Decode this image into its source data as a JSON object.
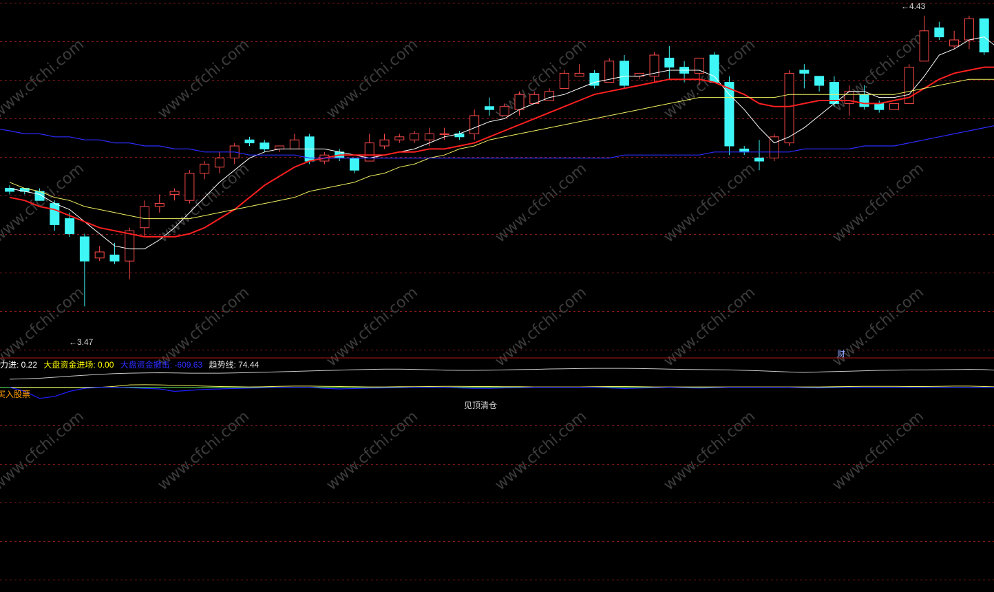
{
  "colors": {
    "background": "#000000",
    "grid": "#8b1a1a",
    "panel_divider": "#b01818",
    "candle_up": "#ff4a4a",
    "candle_down": "#3ff6f6",
    "ma5": "#ffffff",
    "ma10": "#ff2020",
    "ma20": "#f0f060",
    "ma60": "#2c2cff",
    "trend_line": "#c8c8c8",
    "buy_bar": "#ff9e00",
    "hold_bar": "#15a1d8",
    "clear_bar": "#8c8c8c",
    "fund_line": "#1f1fff",
    "zero_line": "#50e050"
  },
  "price_panel": {
    "high_label": "4.43",
    "low_label": "3.47",
    "fin_marker": "财"
  },
  "indicator_panel": {
    "header": [
      {
        "text": "力进: 0.22",
        "color": "#ffffff"
      },
      {
        "text": "大盘资金进场: 0.00",
        "color": "#ffff00"
      },
      {
        "text": "大盘资金撤击: -609.63",
        "color": "#2c2cff"
      },
      {
        "text": "趋势线: 74.44",
        "color": "#e0e0e0"
      }
    ],
    "buy_label": "买入股票",
    "clear_label": "见顶清仓"
  },
  "watermark": "www.cfchi.com",
  "chart_data": {
    "type": "candlestick",
    "title": "",
    "y_range": [
      3.3,
      4.45
    ],
    "candles": [
      {
        "o": 3.86,
        "h": 3.87,
        "l": 3.84,
        "c": 3.85
      },
      {
        "o": 3.86,
        "h": 3.86,
        "l": 3.84,
        "c": 3.85
      },
      {
        "o": 3.85,
        "h": 3.86,
        "l": 3.82,
        "c": 3.82
      },
      {
        "o": 3.81,
        "h": 3.82,
        "l": 3.72,
        "c": 3.74
      },
      {
        "o": 3.76,
        "h": 3.78,
        "l": 3.7,
        "c": 3.71
      },
      {
        "o": 3.7,
        "h": 3.71,
        "l": 3.47,
        "c": 3.62
      },
      {
        "o": 3.63,
        "h": 3.67,
        "l": 3.62,
        "c": 3.65
      },
      {
        "o": 3.64,
        "h": 3.68,
        "l": 3.61,
        "c": 3.62
      },
      {
        "o": 3.62,
        "h": 3.73,
        "l": 3.56,
        "c": 3.72
      },
      {
        "o": 3.73,
        "h": 3.82,
        "l": 3.7,
        "c": 3.8
      },
      {
        "o": 3.8,
        "h": 3.84,
        "l": 3.78,
        "c": 3.81
      },
      {
        "o": 3.84,
        "h": 3.86,
        "l": 3.82,
        "c": 3.85
      },
      {
        "o": 3.82,
        "h": 3.92,
        "l": 3.81,
        "c": 3.91
      },
      {
        "o": 3.91,
        "h": 3.95,
        "l": 3.89,
        "c": 3.94
      },
      {
        "o": 3.93,
        "h": 3.98,
        "l": 3.91,
        "c": 3.96
      },
      {
        "o": 3.96,
        "h": 4.01,
        "l": 3.94,
        "c": 4.0
      },
      {
        "o": 4.02,
        "h": 4.03,
        "l": 4.0,
        "c": 4.01
      },
      {
        "o": 4.01,
        "h": 4.02,
        "l": 3.98,
        "c": 3.99
      },
      {
        "o": 3.99,
        "h": 4.0,
        "l": 3.98,
        "c": 4.0
      },
      {
        "o": 3.99,
        "h": 4.04,
        "l": 3.99,
        "c": 4.02
      },
      {
        "o": 4.03,
        "h": 4.04,
        "l": 3.94,
        "c": 3.95
      },
      {
        "o": 3.95,
        "h": 3.98,
        "l": 3.94,
        "c": 3.97
      },
      {
        "o": 3.98,
        "h": 3.99,
        "l": 3.95,
        "c": 3.96
      },
      {
        "o": 3.96,
        "h": 3.96,
        "l": 3.91,
        "c": 3.92
      },
      {
        "o": 3.95,
        "h": 4.04,
        "l": 3.95,
        "c": 4.01
      },
      {
        "o": 4.0,
        "h": 4.04,
        "l": 3.99,
        "c": 4.02
      },
      {
        "o": 4.02,
        "h": 4.04,
        "l": 4.01,
        "c": 4.03
      },
      {
        "o": 4.02,
        "h": 4.05,
        "l": 4.01,
        "c": 4.04
      },
      {
        "o": 4.02,
        "h": 4.06,
        "l": 4.0,
        "c": 4.04
      },
      {
        "o": 4.04,
        "h": 4.06,
        "l": 4.02,
        "c": 4.04
      },
      {
        "o": 4.04,
        "h": 4.05,
        "l": 4.02,
        "c": 4.03
      },
      {
        "o": 4.04,
        "h": 4.12,
        "l": 4.02,
        "c": 4.1
      },
      {
        "o": 4.13,
        "h": 4.16,
        "l": 4.1,
        "c": 4.12
      },
      {
        "o": 4.1,
        "h": 4.14,
        "l": 4.1,
        "c": 4.13
      },
      {
        "o": 4.12,
        "h": 4.18,
        "l": 4.1,
        "c": 4.17
      },
      {
        "o": 4.14,
        "h": 4.18,
        "l": 4.14,
        "c": 4.17
      },
      {
        "o": 4.15,
        "h": 4.19,
        "l": 4.15,
        "c": 4.18
      },
      {
        "o": 4.19,
        "h": 4.25,
        "l": 4.19,
        "c": 4.24
      },
      {
        "o": 4.23,
        "h": 4.27,
        "l": 4.23,
        "c": 4.24
      },
      {
        "o": 4.24,
        "h": 4.25,
        "l": 4.19,
        "c": 4.2
      },
      {
        "o": 4.21,
        "h": 4.29,
        "l": 4.21,
        "c": 4.28
      },
      {
        "o": 4.28,
        "h": 4.3,
        "l": 4.19,
        "c": 4.2
      },
      {
        "o": 4.23,
        "h": 4.24,
        "l": 4.22,
        "c": 4.24
      },
      {
        "o": 4.23,
        "h": 4.31,
        "l": 4.21,
        "c": 4.3
      },
      {
        "o": 4.29,
        "h": 4.33,
        "l": 4.22,
        "c": 4.26
      },
      {
        "o": 4.26,
        "h": 4.28,
        "l": 4.21,
        "c": 4.24
      },
      {
        "o": 4.24,
        "h": 4.29,
        "l": 4.2,
        "c": 4.29
      },
      {
        "o": 4.3,
        "h": 4.31,
        "l": 4.21,
        "c": 4.21
      },
      {
        "o": 4.21,
        "h": 4.23,
        "l": 3.97,
        "c": 4.0
      },
      {
        "o": 3.99,
        "h": 4.0,
        "l": 3.97,
        "c": 3.98
      },
      {
        "o": 3.96,
        "h": 4.02,
        "l": 3.92,
        "c": 3.95
      },
      {
        "o": 3.96,
        "h": 4.04,
        "l": 3.95,
        "c": 4.03
      },
      {
        "o": 4.01,
        "h": 4.25,
        "l": 4.0,
        "c": 4.24
      },
      {
        "o": 4.25,
        "h": 4.27,
        "l": 4.19,
        "c": 4.24
      },
      {
        "o": 4.23,
        "h": 4.23,
        "l": 4.18,
        "c": 4.2
      },
      {
        "o": 4.21,
        "h": 4.23,
        "l": 4.13,
        "c": 4.14
      },
      {
        "o": 4.14,
        "h": 4.2,
        "l": 4.1,
        "c": 4.18
      },
      {
        "o": 4.17,
        "h": 4.2,
        "l": 4.12,
        "c": 4.13
      },
      {
        "o": 4.14,
        "h": 4.15,
        "l": 4.11,
        "c": 4.12
      },
      {
        "o": 4.12,
        "h": 4.14,
        "l": 4.12,
        "c": 4.14
      },
      {
        "o": 4.14,
        "h": 4.27,
        "l": 4.14,
        "c": 4.26
      },
      {
        "o": 4.28,
        "h": 4.43,
        "l": 4.28,
        "c": 4.38
      },
      {
        "o": 4.39,
        "h": 4.41,
        "l": 4.35,
        "c": 4.36
      },
      {
        "o": 4.33,
        "h": 4.38,
        "l": 4.32,
        "c": 4.35
      },
      {
        "o": 4.35,
        "h": 4.43,
        "l": 4.32,
        "c": 4.42
      },
      {
        "o": 4.42,
        "h": 4.42,
        "l": 4.3,
        "c": 4.31
      },
      {
        "o": 4.29,
        "h": 4.31,
        "l": 4.16,
        "c": 4.18
      },
      {
        "o": 4.18,
        "h": 4.37,
        "l": 4.15,
        "c": 4.29
      }
    ],
    "moving_averages": [
      {
        "name": "MA5",
        "values": [
          3.86,
          3.85,
          3.84,
          3.81,
          3.79,
          3.75,
          3.71,
          3.67,
          3.66,
          3.66,
          3.69,
          3.73,
          3.78,
          3.83,
          3.88,
          3.92,
          3.96,
          3.98,
          3.99,
          3.99,
          3.99,
          3.99,
          3.98,
          3.97,
          3.96,
          3.97,
          3.98,
          3.99,
          4.01,
          4.03,
          4.04,
          4.06,
          4.08,
          4.09,
          4.12,
          4.14,
          4.16,
          4.17,
          4.19,
          4.21,
          4.22,
          4.23,
          4.23,
          4.24,
          4.25,
          4.25,
          4.25,
          4.23,
          4.17,
          4.12,
          4.06,
          4.01,
          4.03,
          4.06,
          4.1,
          4.14,
          4.18,
          4.18,
          4.16,
          4.16,
          4.17,
          4.23,
          4.3,
          4.32,
          4.35,
          4.36,
          4.32,
          4.31
        ]
      },
      {
        "name": "MA10",
        "values": [
          3.83,
          3.82,
          3.8,
          3.79,
          3.77,
          3.75,
          3.73,
          3.72,
          3.71,
          3.7,
          3.7,
          3.7,
          3.71,
          3.73,
          3.76,
          3.79,
          3.83,
          3.87,
          3.9,
          3.93,
          3.95,
          3.96,
          3.97,
          3.97,
          3.97,
          3.97,
          3.98,
          3.98,
          3.99,
          3.99,
          4.0,
          4.01,
          4.03,
          4.05,
          4.07,
          4.09,
          4.11,
          4.13,
          4.15,
          4.17,
          4.18,
          4.19,
          4.2,
          4.21,
          4.22,
          4.22,
          4.22,
          4.21,
          4.19,
          4.17,
          4.14,
          4.13,
          4.13,
          4.14,
          4.15,
          4.15,
          4.15,
          4.14,
          4.14,
          4.15,
          4.16,
          4.19,
          4.22,
          4.24,
          4.25,
          4.26,
          4.26,
          4.28
        ]
      },
      {
        "name": "MA20",
        "values": [
          3.88,
          3.86,
          3.85,
          3.83,
          3.82,
          3.8,
          3.79,
          3.78,
          3.77,
          3.76,
          3.76,
          3.76,
          3.76,
          3.77,
          3.78,
          3.79,
          3.8,
          3.81,
          3.82,
          3.83,
          3.85,
          3.86,
          3.87,
          3.88,
          3.9,
          3.91,
          3.93,
          3.94,
          3.96,
          3.97,
          3.99,
          4.0,
          4.02,
          4.03,
          4.04,
          4.05,
          4.06,
          4.07,
          4.08,
          4.09,
          4.1,
          4.11,
          4.12,
          4.13,
          4.14,
          4.15,
          4.16,
          4.16,
          4.16,
          4.16,
          4.16,
          4.16,
          4.17,
          4.17,
          4.17,
          4.17,
          4.17,
          4.17,
          4.17,
          4.17,
          4.18,
          4.19,
          4.2,
          4.21,
          4.22,
          4.22,
          4.22,
          4.23
        ]
      },
      {
        "name": "MA60",
        "values": [
          4.05,
          4.04,
          4.04,
          4.03,
          4.03,
          4.02,
          4.02,
          4.01,
          4.01,
          4.0,
          4.0,
          3.99,
          3.99,
          3.98,
          3.98,
          3.98,
          3.97,
          3.97,
          3.97,
          3.97,
          3.96,
          3.96,
          3.96,
          3.96,
          3.96,
          3.96,
          3.96,
          3.96,
          3.96,
          3.96,
          3.96,
          3.96,
          3.96,
          3.96,
          3.96,
          3.96,
          3.96,
          3.96,
          3.96,
          3.96,
          3.96,
          3.97,
          3.97,
          3.97,
          3.97,
          3.97,
          3.97,
          3.98,
          3.98,
          3.98,
          3.98,
          3.98,
          3.98,
          3.99,
          3.99,
          3.99,
          3.99,
          4.0,
          4.0,
          4.0,
          4.01,
          4.02,
          4.03,
          4.04,
          4.05,
          4.06,
          4.07,
          4.09
        ]
      }
    ],
    "indicator": {
      "y_range": [
        -1000,
        125
      ],
      "trend_line": [
        40,
        42,
        45,
        50,
        55,
        60,
        64,
        68,
        70,
        71,
        72,
        71,
        70,
        70,
        70,
        71,
        73,
        75,
        77,
        79,
        81,
        83,
        85,
        87,
        89,
        90,
        90,
        89,
        87,
        85,
        84,
        84,
        85,
        86,
        88,
        89,
        91,
        92,
        93,
        94,
        94,
        94,
        93,
        92,
        90,
        89,
        88,
        87,
        86,
        84,
        82,
        79,
        76,
        74,
        76,
        78,
        80,
        82,
        84,
        85,
        86,
        86,
        87,
        88,
        89,
        88,
        84,
        80
      ],
      "fund_line": [
        0,
        -20,
        -55,
        -45,
        -20,
        -5,
        0,
        0,
        -2,
        -5,
        -8,
        -20,
        -15,
        -10,
        -8,
        -6,
        -4,
        -2,
        0,
        0,
        0,
        -5,
        -8,
        -6,
        -4,
        -3,
        -2,
        0,
        0,
        0,
        -3,
        -5,
        -5,
        -3,
        -2,
        0,
        0,
        0,
        0,
        0,
        -3,
        -6,
        -4,
        -2,
        0,
        -2,
        -4,
        -2,
        0,
        0,
        0,
        0,
        0,
        -2,
        -3,
        -2,
        0,
        0,
        0,
        0,
        0,
        0,
        0,
        0,
        0,
        0,
        0,
        -1000
      ],
      "ma_lines": [
        {
          "values": [
            0,
            0,
            0,
            0,
            0,
            0,
            0,
            5,
            12,
            13,
            12,
            10,
            8,
            6,
            4,
            3,
            2,
            3,
            5,
            6,
            6,
            5,
            4,
            3,
            2,
            2,
            3,
            3,
            4,
            5,
            5,
            4,
            4,
            3,
            3,
            2,
            2,
            2,
            2,
            3,
            4,
            4,
            3,
            2,
            2,
            2,
            2,
            2,
            2,
            2,
            2,
            2,
            2,
            2,
            2,
            3,
            4,
            5,
            5,
            5,
            4,
            4,
            5,
            6,
            6,
            4,
            2,
            0
          ]
        }
      ],
      "buy_zones": [
        [
          0,
          1
        ],
        [
          5,
          7
        ]
      ],
      "hold_zones": [
        [
          1,
          4
        ]
      ],
      "clear_zones": [
        [
          30,
          39
        ]
      ]
    }
  }
}
